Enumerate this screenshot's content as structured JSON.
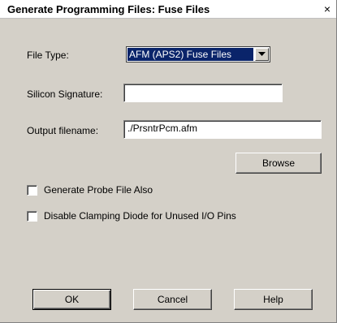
{
  "window": {
    "title": "Generate Programming Files: Fuse Files",
    "close_glyph": "×"
  },
  "file_type": {
    "label": "File Type:",
    "selected": "AFM (APS2) Fuse Files"
  },
  "silicon_signature": {
    "label": "Silicon Signature:",
    "value": ""
  },
  "output_filename": {
    "label": "Output filename:",
    "value": "./PrsntrPcm.afm"
  },
  "browse_label": "Browse",
  "options": {
    "probe_file_label": "Generate Probe File Also",
    "probe_file_checked": false,
    "disable_clamping_label": "Disable Clamping Diode for Unused I/O Pins",
    "disable_clamping_checked": false
  },
  "buttons": {
    "ok": "OK",
    "cancel": "Cancel",
    "help": "Help"
  },
  "colors": {
    "dialog_bg": "#d4d0c8",
    "selection_bg": "#0a246a"
  }
}
